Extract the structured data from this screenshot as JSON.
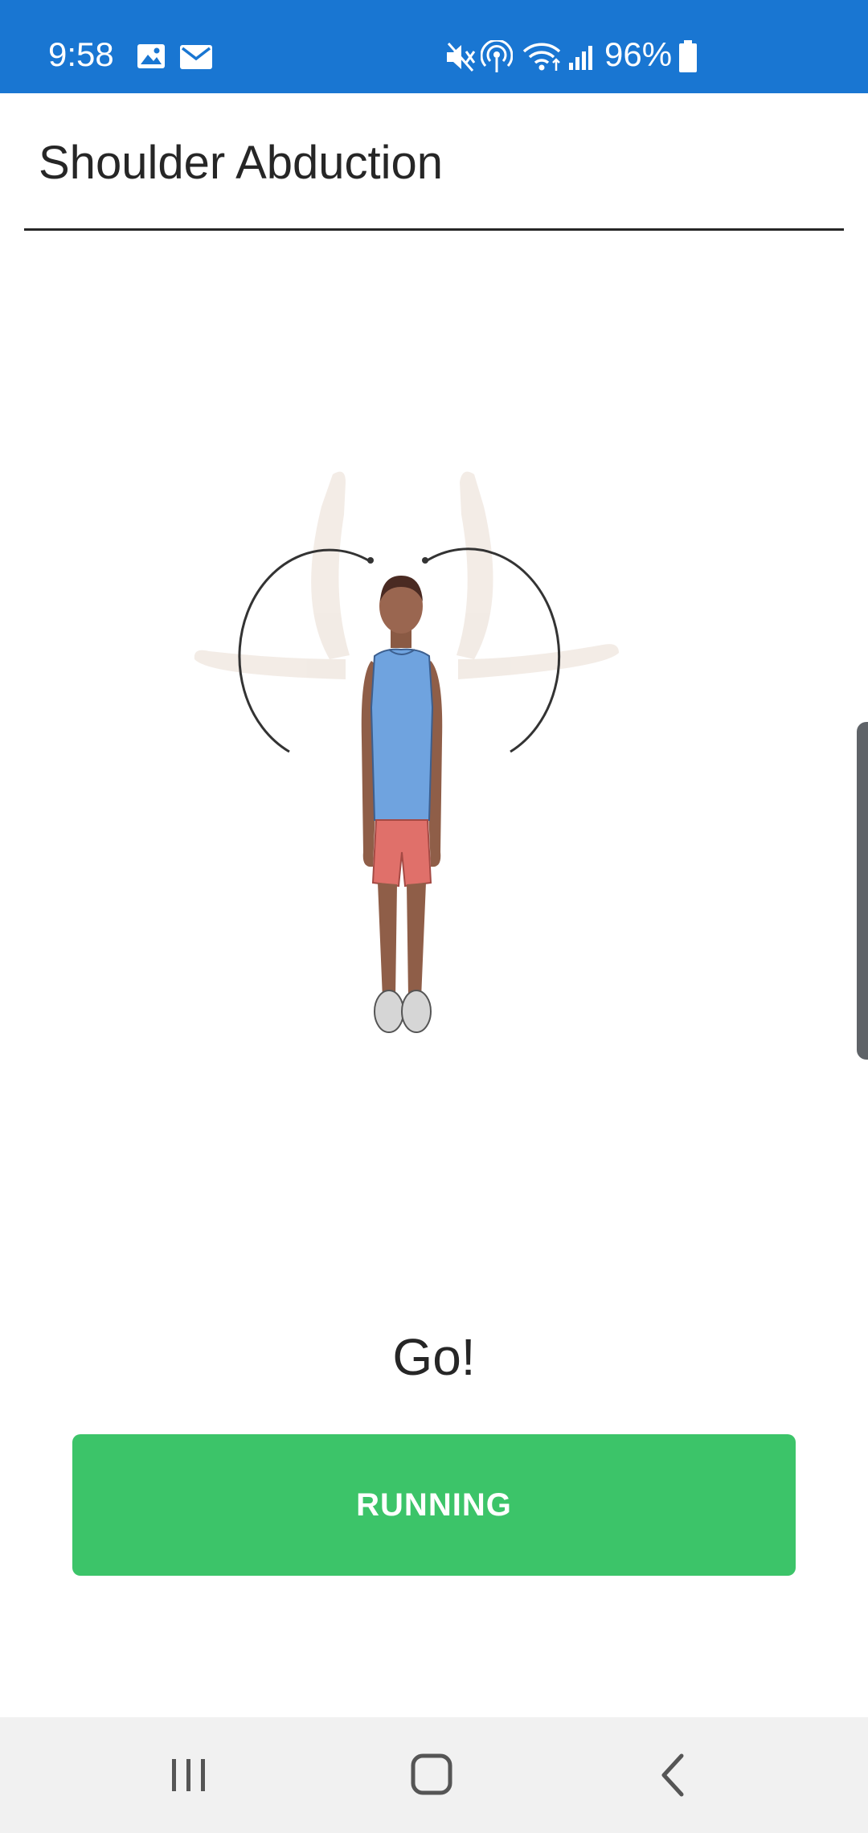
{
  "status_bar": {
    "time": "9:58",
    "battery": "96%",
    "icons": [
      "image-icon",
      "mail-icon",
      "mute-icon",
      "hotspot-icon",
      "wifi-icon",
      "signal-icon",
      "battery-icon"
    ]
  },
  "header": {
    "title": "Shoulder Abduction"
  },
  "main": {
    "illustration_icon": "shoulder-abduction-figure",
    "status_text": "Go!",
    "button_label": "RUNNING"
  },
  "nav_bar": {
    "icons": [
      "recent-apps-icon",
      "home-icon",
      "back-icon"
    ]
  },
  "colors": {
    "status_bar": "#1976d2",
    "button": "#3cc469",
    "shirt": "#6fa3df",
    "shorts": "#e0706a"
  }
}
